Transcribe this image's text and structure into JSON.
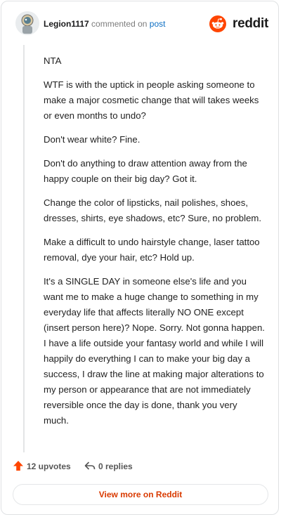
{
  "header": {
    "username": "Legion1117",
    "action_text": "commented on",
    "post_link": "post",
    "brand": "reddit"
  },
  "comment": {
    "paragraphs": [
      "NTA",
      "WTF is with the uptick in people asking someone to make a major cosmetic change that will takes weeks or even months to undo?",
      "Don't wear white? Fine.",
      "Don't do anything to draw attention away from the happy couple on their big day? Got it.",
      "Change the color of lipsticks, nail polishes, shoes, dresses, shirts, eye shadows, etc? Sure, no problem.",
      "Make a difficult to undo hairstyle change, laser tattoo removal, dye your hair, etc? Hold up.",
      "It's a SINGLE DAY in someone else's life and you want me to make a huge change to something in my everyday life that affects literally NO ONE except (insert person here)? Nope. Sorry. Not gonna happen. I have a life outside your fantasy world and while I will happily do everything I can to make your big day a success, I draw the line at making major alterations to my person or appearance that are not immediately reversible once the day is done, thank you very much."
    ]
  },
  "actions": {
    "upvotes": "12 upvotes",
    "replies": "0 replies"
  },
  "footer": {
    "view_button": "View more on Reddit"
  },
  "colors": {
    "brand_orange": "#ff4500",
    "link_blue": "#0b6ec3",
    "button_text": "#d93a00"
  }
}
